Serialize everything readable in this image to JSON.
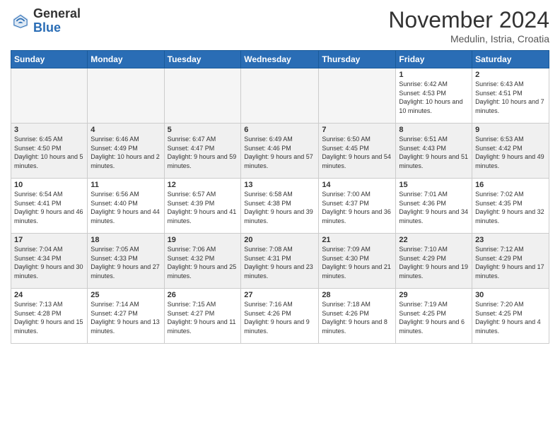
{
  "header": {
    "logo_general": "General",
    "logo_blue": "Blue",
    "month_title": "November 2024",
    "location": "Medulin, Istria, Croatia"
  },
  "columns": [
    "Sunday",
    "Monday",
    "Tuesday",
    "Wednesday",
    "Thursday",
    "Friday",
    "Saturday"
  ],
  "weeks": [
    [
      {
        "day": "",
        "sunrise": "",
        "sunset": "",
        "daylight": "",
        "empty": true
      },
      {
        "day": "",
        "sunrise": "",
        "sunset": "",
        "daylight": "",
        "empty": true
      },
      {
        "day": "",
        "sunrise": "",
        "sunset": "",
        "daylight": "",
        "empty": true
      },
      {
        "day": "",
        "sunrise": "",
        "sunset": "",
        "daylight": "",
        "empty": true
      },
      {
        "day": "",
        "sunrise": "",
        "sunset": "",
        "daylight": "",
        "empty": true
      },
      {
        "day": "1",
        "sunrise": "Sunrise: 6:42 AM",
        "sunset": "Sunset: 4:53 PM",
        "daylight": "Daylight: 10 hours and 10 minutes.",
        "empty": false
      },
      {
        "day": "2",
        "sunrise": "Sunrise: 6:43 AM",
        "sunset": "Sunset: 4:51 PM",
        "daylight": "Daylight: 10 hours and 7 minutes.",
        "empty": false
      }
    ],
    [
      {
        "day": "3",
        "sunrise": "Sunrise: 6:45 AM",
        "sunset": "Sunset: 4:50 PM",
        "daylight": "Daylight: 10 hours and 5 minutes.",
        "empty": false
      },
      {
        "day": "4",
        "sunrise": "Sunrise: 6:46 AM",
        "sunset": "Sunset: 4:49 PM",
        "daylight": "Daylight: 10 hours and 2 minutes.",
        "empty": false
      },
      {
        "day": "5",
        "sunrise": "Sunrise: 6:47 AM",
        "sunset": "Sunset: 4:47 PM",
        "daylight": "Daylight: 9 hours and 59 minutes.",
        "empty": false
      },
      {
        "day": "6",
        "sunrise": "Sunrise: 6:49 AM",
        "sunset": "Sunset: 4:46 PM",
        "daylight": "Daylight: 9 hours and 57 minutes.",
        "empty": false
      },
      {
        "day": "7",
        "sunrise": "Sunrise: 6:50 AM",
        "sunset": "Sunset: 4:45 PM",
        "daylight": "Daylight: 9 hours and 54 minutes.",
        "empty": false
      },
      {
        "day": "8",
        "sunrise": "Sunrise: 6:51 AM",
        "sunset": "Sunset: 4:43 PM",
        "daylight": "Daylight: 9 hours and 51 minutes.",
        "empty": false
      },
      {
        "day": "9",
        "sunrise": "Sunrise: 6:53 AM",
        "sunset": "Sunset: 4:42 PM",
        "daylight": "Daylight: 9 hours and 49 minutes.",
        "empty": false
      }
    ],
    [
      {
        "day": "10",
        "sunrise": "Sunrise: 6:54 AM",
        "sunset": "Sunset: 4:41 PM",
        "daylight": "Daylight: 9 hours and 46 minutes.",
        "empty": false
      },
      {
        "day": "11",
        "sunrise": "Sunrise: 6:56 AM",
        "sunset": "Sunset: 4:40 PM",
        "daylight": "Daylight: 9 hours and 44 minutes.",
        "empty": false
      },
      {
        "day": "12",
        "sunrise": "Sunrise: 6:57 AM",
        "sunset": "Sunset: 4:39 PM",
        "daylight": "Daylight: 9 hours and 41 minutes.",
        "empty": false
      },
      {
        "day": "13",
        "sunrise": "Sunrise: 6:58 AM",
        "sunset": "Sunset: 4:38 PM",
        "daylight": "Daylight: 9 hours and 39 minutes.",
        "empty": false
      },
      {
        "day": "14",
        "sunrise": "Sunrise: 7:00 AM",
        "sunset": "Sunset: 4:37 PM",
        "daylight": "Daylight: 9 hours and 36 minutes.",
        "empty": false
      },
      {
        "day": "15",
        "sunrise": "Sunrise: 7:01 AM",
        "sunset": "Sunset: 4:36 PM",
        "daylight": "Daylight: 9 hours and 34 minutes.",
        "empty": false
      },
      {
        "day": "16",
        "sunrise": "Sunrise: 7:02 AM",
        "sunset": "Sunset: 4:35 PM",
        "daylight": "Daylight: 9 hours and 32 minutes.",
        "empty": false
      }
    ],
    [
      {
        "day": "17",
        "sunrise": "Sunrise: 7:04 AM",
        "sunset": "Sunset: 4:34 PM",
        "daylight": "Daylight: 9 hours and 30 minutes.",
        "empty": false
      },
      {
        "day": "18",
        "sunrise": "Sunrise: 7:05 AM",
        "sunset": "Sunset: 4:33 PM",
        "daylight": "Daylight: 9 hours and 27 minutes.",
        "empty": false
      },
      {
        "day": "19",
        "sunrise": "Sunrise: 7:06 AM",
        "sunset": "Sunset: 4:32 PM",
        "daylight": "Daylight: 9 hours and 25 minutes.",
        "empty": false
      },
      {
        "day": "20",
        "sunrise": "Sunrise: 7:08 AM",
        "sunset": "Sunset: 4:31 PM",
        "daylight": "Daylight: 9 hours and 23 minutes.",
        "empty": false
      },
      {
        "day": "21",
        "sunrise": "Sunrise: 7:09 AM",
        "sunset": "Sunset: 4:30 PM",
        "daylight": "Daylight: 9 hours and 21 minutes.",
        "empty": false
      },
      {
        "day": "22",
        "sunrise": "Sunrise: 7:10 AM",
        "sunset": "Sunset: 4:29 PM",
        "daylight": "Daylight: 9 hours and 19 minutes.",
        "empty": false
      },
      {
        "day": "23",
        "sunrise": "Sunrise: 7:12 AM",
        "sunset": "Sunset: 4:29 PM",
        "daylight": "Daylight: 9 hours and 17 minutes.",
        "empty": false
      }
    ],
    [
      {
        "day": "24",
        "sunrise": "Sunrise: 7:13 AM",
        "sunset": "Sunset: 4:28 PM",
        "daylight": "Daylight: 9 hours and 15 minutes.",
        "empty": false
      },
      {
        "day": "25",
        "sunrise": "Sunrise: 7:14 AM",
        "sunset": "Sunset: 4:27 PM",
        "daylight": "Daylight: 9 hours and 13 minutes.",
        "empty": false
      },
      {
        "day": "26",
        "sunrise": "Sunrise: 7:15 AM",
        "sunset": "Sunset: 4:27 PM",
        "daylight": "Daylight: 9 hours and 11 minutes.",
        "empty": false
      },
      {
        "day": "27",
        "sunrise": "Sunrise: 7:16 AM",
        "sunset": "Sunset: 4:26 PM",
        "daylight": "Daylight: 9 hours and 9 minutes.",
        "empty": false
      },
      {
        "day": "28",
        "sunrise": "Sunrise: 7:18 AM",
        "sunset": "Sunset: 4:26 PM",
        "daylight": "Daylight: 9 hours and 8 minutes.",
        "empty": false
      },
      {
        "day": "29",
        "sunrise": "Sunrise: 7:19 AM",
        "sunset": "Sunset: 4:25 PM",
        "daylight": "Daylight: 9 hours and 6 minutes.",
        "empty": false
      },
      {
        "day": "30",
        "sunrise": "Sunrise: 7:20 AM",
        "sunset": "Sunset: 4:25 PM",
        "daylight": "Daylight: 9 hours and 4 minutes.",
        "empty": false
      }
    ]
  ]
}
